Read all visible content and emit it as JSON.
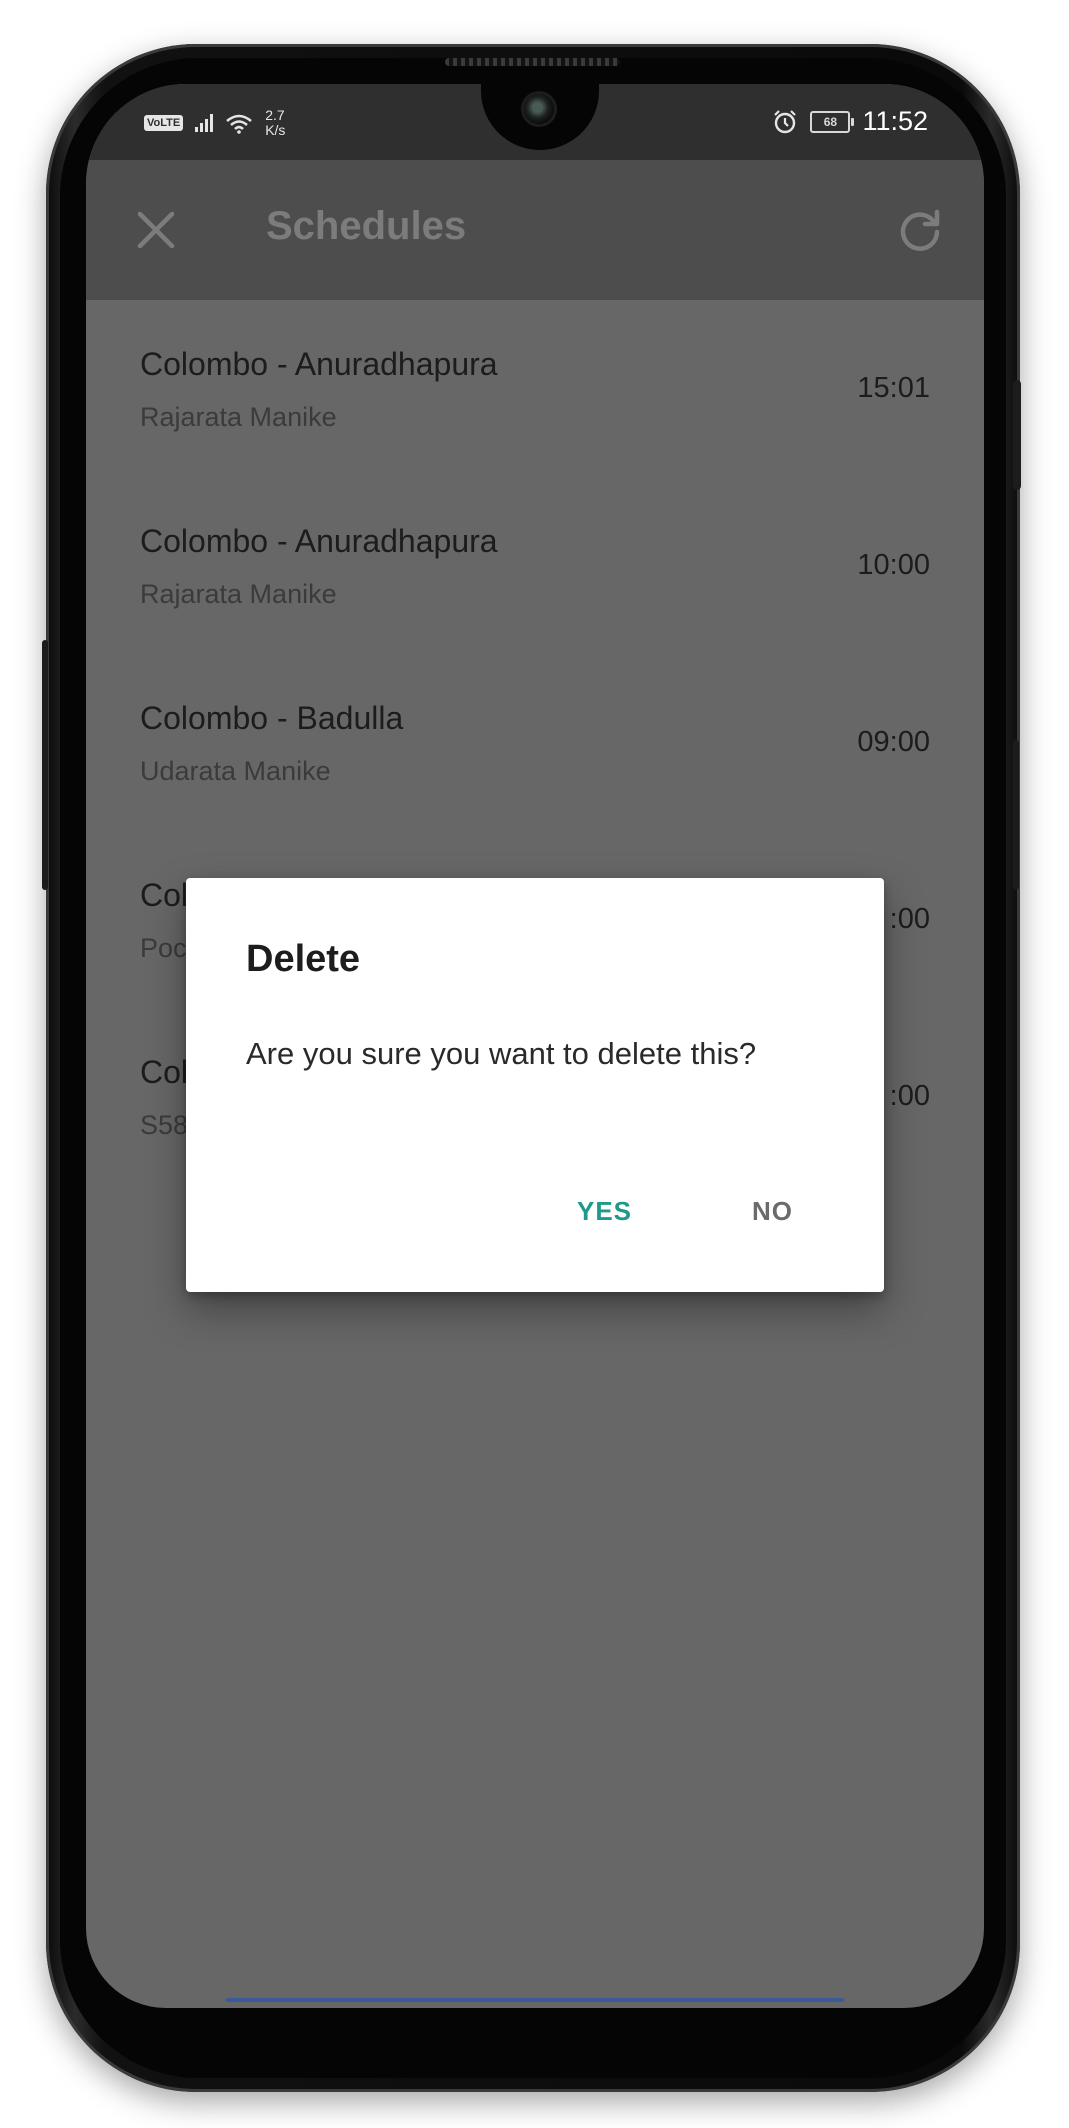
{
  "status_bar": {
    "network_badge": "VoLTE",
    "net_speed_value": "2.7",
    "net_speed_unit": "K/s",
    "battery": "68",
    "time": "11:52",
    "icons": [
      "signal-icon",
      "wifi-icon",
      "alarm-icon",
      "battery-icon"
    ]
  },
  "app_bar": {
    "title": "Schedules",
    "close_icon": "close-icon",
    "refresh_icon": "refresh-icon"
  },
  "schedules": [
    {
      "route": "Colombo - Anuradhapura",
      "train": "Rajarata Manike",
      "time": "15:01"
    },
    {
      "route": "Colombo - Anuradhapura",
      "train": "Rajarata Manike",
      "time": "10:00"
    },
    {
      "route": "Colombo - Badulla",
      "train": "Udarata Manike",
      "time": "09:00"
    },
    {
      "route": "Col",
      "train": "Poc",
      "time": ":00"
    },
    {
      "route": "Col",
      "train": "S58",
      "time": ":00"
    }
  ],
  "dialog": {
    "title": "Delete",
    "message": "Are you sure you want to delete this?",
    "yes_label": "YES",
    "no_label": "NO"
  },
  "colors": {
    "accent": "#1f9a8a",
    "scrim_background": "#676767",
    "app_bar": "#4d4d4d"
  }
}
